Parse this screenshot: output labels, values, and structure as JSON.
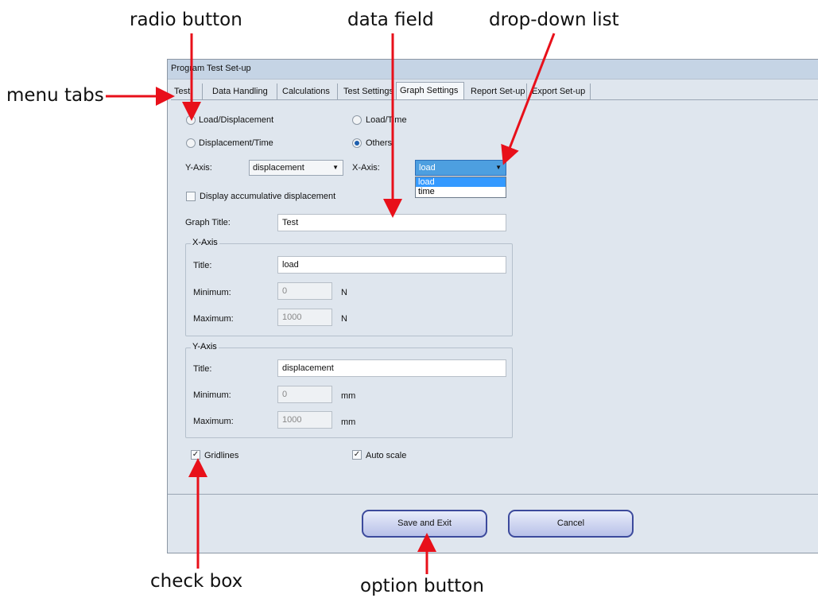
{
  "annotations": {
    "radio_button": "radio button",
    "data_field": "data field",
    "drop_down_list": "drop-down list",
    "menu_tabs": "menu tabs",
    "check_box": "check box",
    "option_button": "option button"
  },
  "window": {
    "title": "Program Test Set-up"
  },
  "tabs": [
    "Test",
    "Data Handling",
    "Calculations",
    "Test Settings",
    "Graph Settings",
    "Report Set-up",
    "Export Set-up"
  ],
  "graph_type": {
    "load_displacement": "Load/Displacement",
    "load_time": "Load/Time",
    "displacement_time": "Displacement/Time",
    "others": "Others",
    "selected": "Others"
  },
  "axis_select": {
    "y_label": "Y-Axis:",
    "y_value": "displacement",
    "x_label": "X-Axis:",
    "x_value": "load",
    "x_options": [
      "load",
      "time"
    ]
  },
  "display_accumulative": {
    "label": "Display accumulative displacement",
    "checked": false
  },
  "graph_title": {
    "label": "Graph Title:",
    "value": "Test"
  },
  "x_axis": {
    "group_label": "X-Axis",
    "title_label": "Title:",
    "title_value": "load",
    "min_label": "Minimum:",
    "min_value": "0",
    "min_unit": "N",
    "max_label": "Maximum:",
    "max_value": "1000",
    "max_unit": "N"
  },
  "y_axis": {
    "group_label": "Y-Axis",
    "title_label": "Title:",
    "title_value": "displacement",
    "min_label": "Minimum:",
    "min_value": "0",
    "min_unit": "mm",
    "max_label": "Maximum:",
    "max_value": "1000",
    "max_unit": "mm"
  },
  "options": {
    "gridlines": {
      "label": "Gridlines",
      "checked": true
    },
    "auto_scale": {
      "label": "Auto scale",
      "checked": true
    }
  },
  "buttons": {
    "save": "Save and Exit",
    "cancel": "Cancel"
  },
  "colors": {
    "arrow": "#e8101a",
    "window_bg": "#dfe6ee",
    "button_border": "#3c4a9c"
  }
}
